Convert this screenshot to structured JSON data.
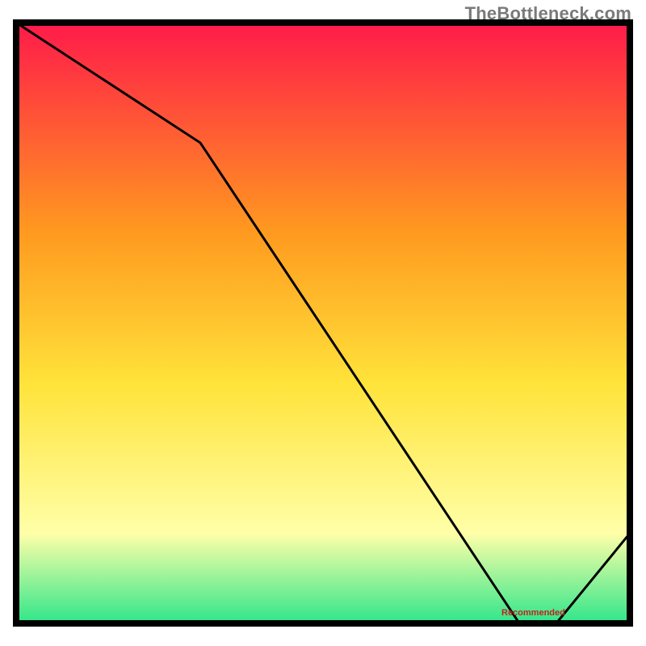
{
  "watermark": "TheBottleneck.com",
  "chart_data": {
    "type": "line",
    "title": "",
    "xlabel": "",
    "ylabel": "",
    "xlim": [
      0,
      100
    ],
    "ylim": [
      0,
      100
    ],
    "series": [
      {
        "name": "curve",
        "x": [
          0,
          30,
          82,
          88,
          100
        ],
        "y": [
          100,
          80,
          0,
          0,
          15
        ]
      }
    ],
    "annotation_label": "Recommended",
    "annotation_x": 85,
    "background_gradient_top": "#ff1a4a",
    "background_gradient_mid_upper": "#ff9a1f",
    "background_gradient_mid": "#ffe33a",
    "background_gradient_lower": "#ffffa8",
    "background_gradient_bottom": "#2fe68a",
    "frame_color": "#000000",
    "curve_color": "#000000"
  }
}
